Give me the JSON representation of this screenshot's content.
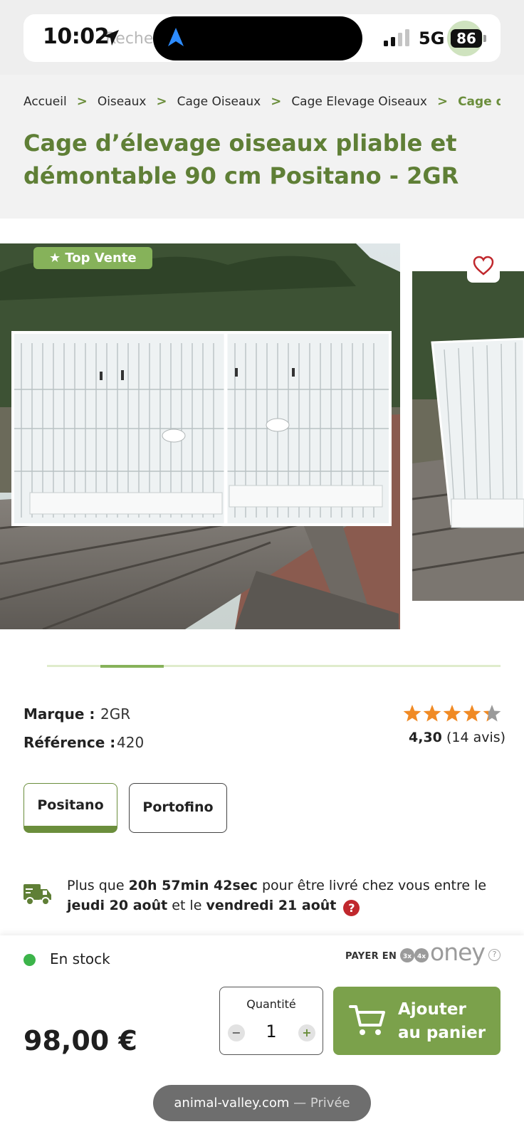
{
  "status_bar": {
    "time": "10:02",
    "search_ghost": "Recherc",
    "network": "5G",
    "battery": "86"
  },
  "breadcrumb": [
    "Accueil",
    "Oiseaux",
    "Cage Oiseaux",
    "Cage Elevage Oiseaux",
    "Cage d’élevag"
  ],
  "product": {
    "title": "Cage d’élevage oiseaux pliable et démontable 90 cm Positano - 2GR",
    "badge": "★ Top Vente",
    "brand_label": "Marque :",
    "brand": "2GR",
    "reference_label": "Référence :",
    "reference": "420",
    "rating_value": "4,30",
    "rating_count": "(14 avis)",
    "stars": 4.3,
    "variants": [
      {
        "label": "Positano",
        "selected": true
      },
      {
        "label": "Portofino",
        "selected": false
      }
    ]
  },
  "gallery": {
    "current_slide": 2,
    "total_slides": 8
  },
  "delivery": {
    "prefix": "Plus que",
    "countdown": "20h 57min 42sec",
    "middle": "pour être livré chez vous entre le",
    "date_from": "jeudi 20 août",
    "joiner": "et le",
    "date_to": "vendredi 21 août",
    "help": "?"
  },
  "purchase": {
    "stock": "En stock",
    "pay_label": "PAYER EN",
    "pay_brand": "oney",
    "pay_help": "?",
    "price": "98,00 €",
    "quantity_label": "Quantité",
    "quantity": "1",
    "minus": "−",
    "plus": "+",
    "add_line1": "Ajouter",
    "add_line2": "au panier"
  },
  "browser": {
    "domain": "animal-valley.com",
    "mode": "— Privée"
  },
  "colors": {
    "brand_green": "#6b8e3c",
    "button_green": "#7ba14b",
    "badge_green": "#86b25a",
    "star_orange": "#f08a24",
    "stock_green": "#3cb44a",
    "alert_red": "#c0282d"
  },
  "icons": [
    "location-arrow-icon",
    "chevron-right-icon",
    "heart-icon",
    "star-icon",
    "delivery-truck-icon",
    "help-icon",
    "cart-icon",
    "signal-icon",
    "battery-icon"
  ]
}
